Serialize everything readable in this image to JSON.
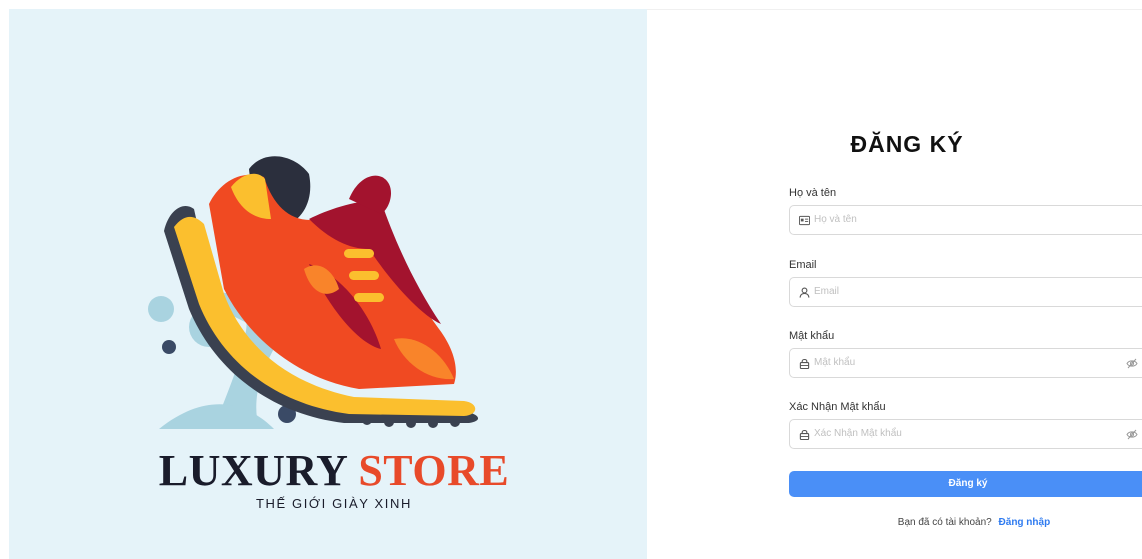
{
  "brand": {
    "name_part1": "LUXURY",
    "name_part2": "STORE",
    "tagline": "THẾ GIỚI GIÀY XINH",
    "colors": {
      "panel_bg": "#e5f3f9",
      "dark": "#1a1c2b",
      "accent": "#e84a2a"
    }
  },
  "form": {
    "title": "ĐĂNG KÝ",
    "fields": [
      {
        "label": "Họ và tên",
        "placeholder": "Họ và tên",
        "icon": "id-card-icon"
      },
      {
        "label": "Email",
        "placeholder": "Email",
        "icon": "user-icon"
      },
      {
        "label": "Mật khẩu",
        "placeholder": "Mật khẩu",
        "icon": "lock-icon",
        "toggle_icon": "eye-off-icon"
      },
      {
        "label": "Xác Nhận Mật khẩu",
        "placeholder": "Xác Nhận Mật khẩu",
        "icon": "lock-icon",
        "toggle_icon": "eye-off-icon"
      }
    ],
    "submit_label": "Đăng ký",
    "login_prompt": "Bạn đã có tài khoản?",
    "login_link": "Đăng nhập",
    "colors": {
      "primary": "#4a8ff7",
      "link": "#2f7bf0"
    }
  }
}
